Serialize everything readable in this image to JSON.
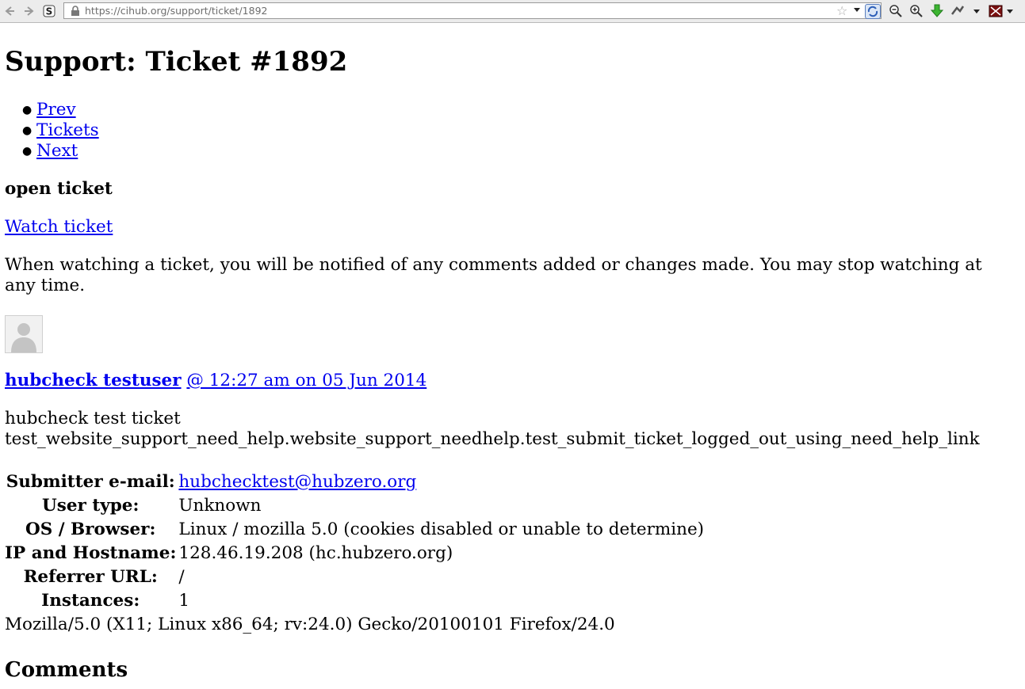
{
  "browser": {
    "url": "https://cihub.org/support/ticket/1892"
  },
  "page": {
    "title": "Support: Ticket #1892",
    "nav": [
      {
        "label": "Prev"
      },
      {
        "label": "Tickets"
      },
      {
        "label": "Next"
      }
    ],
    "status": "open ticket",
    "watch_link": "Watch ticket",
    "watch_note": "When watching a ticket, you will be notified of any comments added or changes made. You may stop watching at any time.",
    "author": "hubcheck testuser",
    "timestamp": "@ 12:27 am on 05 Jun 2014",
    "message_line1": "hubcheck test ticket",
    "message_line2": "test_website_support_need_help.website_support_needhelp.test_submit_ticket_logged_out_using_need_help_link",
    "details": {
      "email_label": "Submitter e-mail:",
      "email_value": "hubchecktest@hubzero.org",
      "usertype_label": "User type:",
      "usertype_value": "Unknown",
      "os_label": "OS / Browser:",
      "os_value": "Linux / mozilla 5.0 (cookies disabled or unable to determine)",
      "ip_label": "IP and Hostname:",
      "ip_value": "128.46.19.208 (hc.hubzero.org)",
      "referrer_label": "Referrer URL:",
      "referrer_value": "/",
      "instances_label": "Instances:",
      "instances_value": "1",
      "user_agent": "Mozilla/5.0 (X11; Linux x86_64; rv:24.0) Gecko/20100101 Firefox/24.0"
    },
    "comments_heading": "Comments"
  }
}
